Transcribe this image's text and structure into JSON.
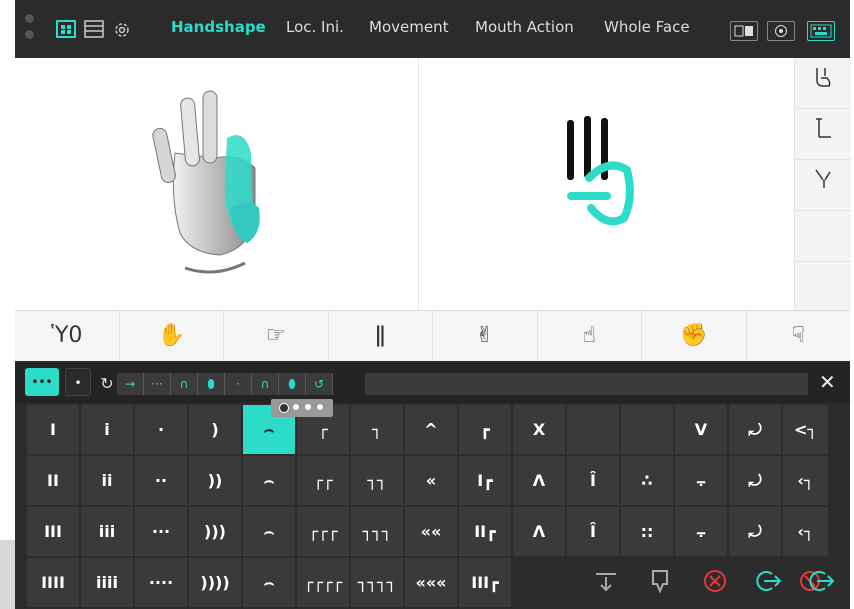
{
  "topbar": {
    "left_icons": [
      "grid-view-icon",
      "list-icon",
      "gear-icon"
    ],
    "tabs": [
      {
        "label": "Handshape",
        "active": true
      },
      {
        "label": "Loc. Ini.",
        "active": false
      },
      {
        "label": "Movement",
        "active": false
      },
      {
        "label": "Mouth Action",
        "active": false
      },
      {
        "label": "Whole Face",
        "active": false
      }
    ],
    "right_icons": [
      "layout-icon",
      "target-icon",
      "keyboard-icon"
    ]
  },
  "viewer": {
    "sidebar_symbols": [
      "⛹",
      "⬑",
      "∖/"
    ]
  },
  "strip": {
    "symbols": [
      "Ὑ0",
      "✋",
      "☞",
      "ǁ",
      "✌",
      "☝",
      "✊",
      "☟"
    ]
  },
  "filter": {
    "mode_buttons": [
      "•••",
      "•"
    ],
    "chain_symbols": [
      "↻",
      "→",
      "···",
      "∩",
      "⬮",
      "·",
      "∩",
      "⬮",
      "↺"
    ],
    "close_label": "✕"
  },
  "grid": {
    "rows": [
      [
        "I",
        "i",
        "·",
        ")",
        "⌢",
        "┌",
        "┐",
        "^",
        "┏",
        "X",
        "",
        "",
        "V",
        "⤾",
        "<┐"
      ],
      [
        "II",
        "ii",
        "··",
        "))",
        "⌢",
        "┌┌",
        "┐┐",
        "«",
        "I┏",
        "Λ",
        "Î",
        "∴",
        "⨪",
        "⤾",
        "‹┐"
      ],
      [
        "III",
        "iii",
        "···",
        ")))",
        "⌢",
        "┌┌┌",
        "┐┐┐",
        "««",
        "II┏",
        "Λ",
        "Î",
        "::",
        "⨪",
        "⤾",
        "‹┐"
      ],
      [
        "IIII",
        "iiii",
        "····",
        "))))",
        "⌢",
        "┌┌┌┌",
        "┐┐┐┐",
        "«««",
        "III┏",
        "",
        "",
        "",
        "",
        "",
        ""
      ]
    ],
    "selected_symbol": "⌢"
  },
  "actions": [
    "insert-down-icon",
    "insert-below-icon",
    "delete-icon",
    "next-icon",
    "next-delete-icon"
  ],
  "colors": {
    "accent": "#2ddbc9",
    "bar": "#2b2b2b",
    "cell": "#3a3a3a",
    "danger": "#e5383b"
  }
}
